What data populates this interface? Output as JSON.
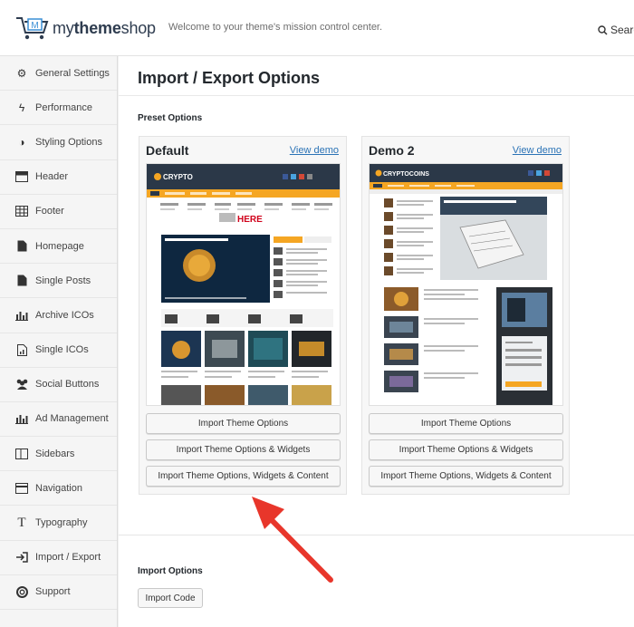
{
  "header": {
    "brand_prefix": "my",
    "brand_bold": "theme",
    "brand_suffix": "shop",
    "logo_letter": "M",
    "tagline": "Welcome to your theme's mission control center.",
    "search_label": "Search"
  },
  "sidebar": {
    "items": [
      {
        "label": "General Settings",
        "icon": "gear-icon"
      },
      {
        "label": "Performance",
        "icon": "bolt-icon"
      },
      {
        "label": "Styling Options",
        "icon": "half-circle-icon"
      },
      {
        "label": "Header",
        "icon": "header-layout-icon"
      },
      {
        "label": "Footer",
        "icon": "table-icon"
      },
      {
        "label": "Homepage",
        "icon": "document-icon"
      },
      {
        "label": "Single Posts",
        "icon": "document-icon"
      },
      {
        "label": "Archive ICOs",
        "icon": "bar-chart-icon"
      },
      {
        "label": "Single ICOs",
        "icon": "document-chart-icon"
      },
      {
        "label": "Social Buttons",
        "icon": "users-icon"
      },
      {
        "label": "Ad Management",
        "icon": "bar-chart-icon"
      },
      {
        "label": "Sidebars",
        "icon": "columns-icon"
      },
      {
        "label": "Navigation",
        "icon": "navigation-icon"
      },
      {
        "label": "Typography",
        "icon": "text-icon"
      },
      {
        "label": "Import / Export",
        "icon": "sign-in-icon"
      },
      {
        "label": "Support",
        "icon": "lifebuoy-icon"
      }
    ]
  },
  "main": {
    "title": "Import / Export Options",
    "preset_label": "Preset Options",
    "import_label": "Import Options",
    "import_code_button": "Import Code"
  },
  "demos": [
    {
      "name": "Default",
      "view_demo": "View demo",
      "site_name": "CRYPTO",
      "banner_word": "HERE",
      "buttons": [
        "Import Theme Options",
        "Import Theme Options & Widgets",
        "Import Theme Options, Widgets & Content"
      ]
    },
    {
      "name": "Demo 2",
      "view_demo": "View demo",
      "site_name": "CRYPTOCOINS",
      "buttons": [
        "Import Theme Options",
        "Import Theme Options & Widgets",
        "Import Theme Options, Widgets & Content"
      ]
    }
  ],
  "colors": {
    "link": "#2b73b6",
    "arrow": "#e8362b",
    "thumb_dark": "#2a3a4c",
    "thumb_accent": "#f5a623"
  }
}
